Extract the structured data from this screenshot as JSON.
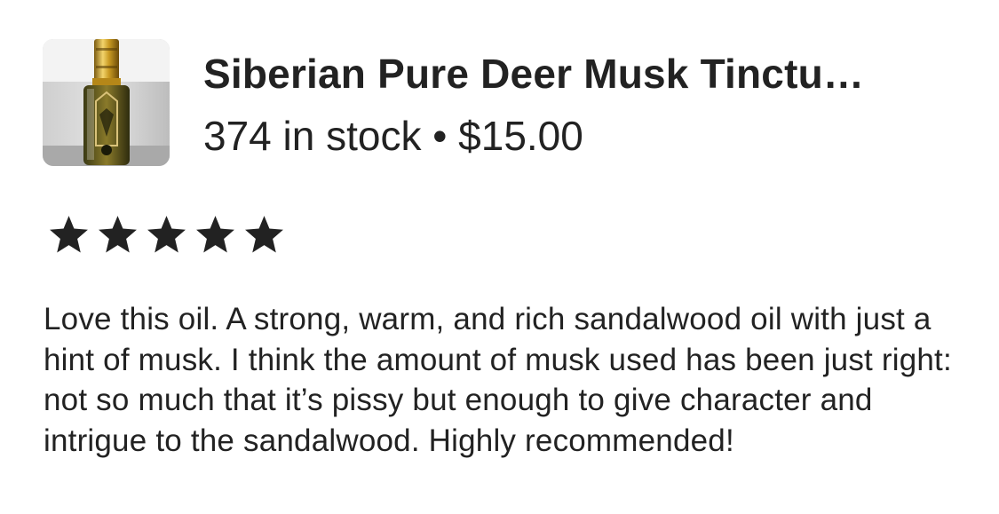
{
  "listing": {
    "title": "Siberian Pure Deer Musk Tinctu…",
    "stock_text": "374 in stock",
    "separator": "•",
    "price": "$15.00",
    "thumbnail_icon": "perfume-bottle-photo"
  },
  "review": {
    "rating": 5,
    "rating_max": 5,
    "star_color": "#222222",
    "text": "Love this oil. A strong, warm, and rich sandalwood oil with just a hint of musk. I think the amount of musk used has been just right: not so much that it’s pissy but enough to give character and intrigue to the sandalwood. Highly recommended!"
  }
}
